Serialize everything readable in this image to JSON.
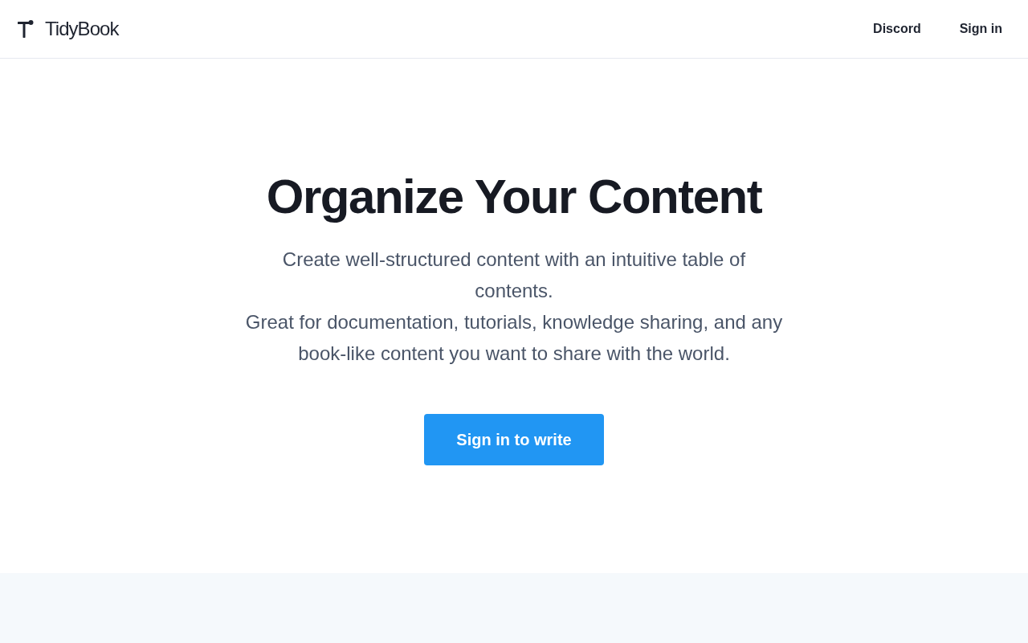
{
  "header": {
    "logo": {
      "name": "TidyBook"
    },
    "nav": [
      "Discord",
      "Sign in"
    ]
  },
  "hero": {
    "title": "Organize Your Content",
    "description": [
      "Create well-structured content with an intuitive table of contents.",
      "Great for documentation, tutorials, knowledge sharing, and any book-like content you want to share with the world."
    ],
    "cta": "Sign in to write"
  }
}
